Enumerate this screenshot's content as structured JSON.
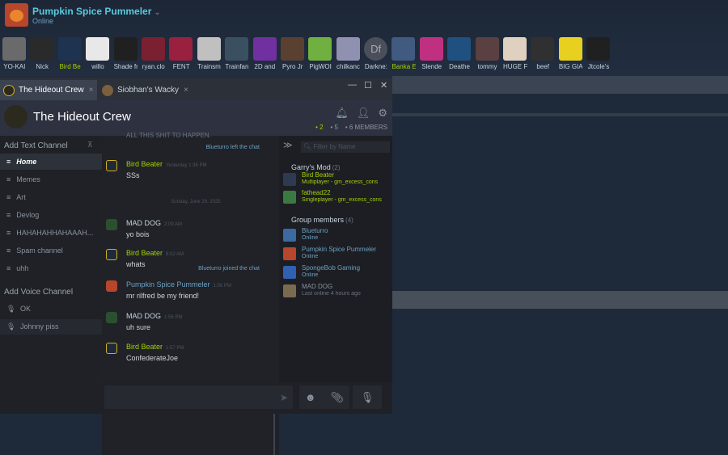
{
  "profile": {
    "name": "Pumpkin Spice Pummeler",
    "status": "Online"
  },
  "friends": [
    {
      "label": "YO-KAI",
      "color": "#6a6a6a",
      "ingame": false
    },
    {
      "label": "Nick",
      "color": "#2a2a2a",
      "ingame": false
    },
    {
      "label": "Bird Be",
      "color": "#1e3350",
      "ingame": true
    },
    {
      "label": "willo",
      "color": "#e8e8e8",
      "ingame": false
    },
    {
      "label": "Shade fr",
      "color": "#202020",
      "ingame": false
    },
    {
      "label": "ryan.clo",
      "color": "#7a2030",
      "ingame": false
    },
    {
      "label": "FENT",
      "color": "#9a2040",
      "ingame": false
    },
    {
      "label": "Trainsm",
      "color": "#c0c0c0",
      "ingame": false
    },
    {
      "label": "Trainfan",
      "color": "#3a5060",
      "ingame": false
    },
    {
      "label": "2D and",
      "color": "#7030a0",
      "ingame": false
    },
    {
      "label": "Pyro Jr",
      "color": "#5a4030",
      "ingame": false
    },
    {
      "label": "PigWOI",
      "color": "#70b040",
      "ingame": false
    },
    {
      "label": "chilkanc",
      "color": "#9090b0",
      "ingame": false
    },
    {
      "label": "Darkne:",
      "color": "#4a4f5a",
      "ingame": false,
      "initials": "Df"
    },
    {
      "label": "Banka E",
      "color": "#405a80",
      "ingame": true
    },
    {
      "label": "Slende",
      "color": "#c03080",
      "ingame": false
    },
    {
      "label": "Deathe",
      "color": "#205080",
      "ingame": false
    },
    {
      "label": "tommy",
      "color": "#5a4040",
      "ingame": false
    },
    {
      "label": "HUGE F",
      "color": "#e0d0c0",
      "ingame": false
    },
    {
      "label": "beef",
      "color": "#303030",
      "ingame": false
    },
    {
      "label": "BIG GIA",
      "color": "#e8d020",
      "ingame": false
    },
    {
      "label": "Jtcole's",
      "color": "#202020",
      "ingame": false
    }
  ],
  "tabs": [
    {
      "label": "The Hideout Crew",
      "close": "×"
    },
    {
      "label": "Siobhan's Wacky",
      "close": "×"
    }
  ],
  "window_controls": {
    "min": "—",
    "max": "☐",
    "close": "✕"
  },
  "group": {
    "name": "The Hideout Crew",
    "counts": {
      "ingame": "• 2",
      "online": "• 5",
      "members": "• 6 MEMBERS"
    }
  },
  "sidebar": {
    "text_header": "Add Text Channel",
    "channels": [
      "Home",
      "Memes",
      "Art",
      "Devlog",
      "HAHAHAHHAHAAAH...",
      "Spam channel",
      "uhh"
    ],
    "voice_header": "Add Voice Channel",
    "voice_channels": [
      "OK",
      "Johnny piss"
    ]
  },
  "chat": {
    "partial_line": "ALL THIS SHIT TO HAPPEN.",
    "system1": "Blueturro left the chat",
    "system2": "Blueturro joined the chat",
    "date_divider": "Sunday, June 29, 2025",
    "messages": [
      {
        "name": "Bird Beater",
        "time": "Yesterday 1:36 PM",
        "text": "SSs",
        "color": "g"
      },
      {
        "name": "MAD DOG",
        "time": "2:09 AM",
        "text": "yo bois",
        "color": "w"
      },
      {
        "name": "Bird Beater",
        "time": "8:02 AM",
        "text": "whats",
        "color": "g"
      },
      {
        "name": "Pumpkin Spice Pummeler",
        "time": "1:56 PM",
        "text": "mr rilfred be my friend!",
        "color": "b"
      },
      {
        "name": "MAD DOG",
        "time": "1:56 PM",
        "text": "uh sure",
        "color": "w"
      },
      {
        "name": "Bird Beater",
        "time": "1:57 PM",
        "text": "ConfederateJoe",
        "color": "g"
      }
    ]
  },
  "members": {
    "filter_placeholder": "Filter by Name",
    "groups": [
      {
        "title": "Garry's Mod",
        "count": "(2)"
      },
      {
        "title": "Group members",
        "count": "(4)"
      }
    ],
    "ingame": [
      {
        "name": "Bird Beater",
        "status": "Multiplayer - gm_excess_cons",
        "color": "#2e3a50"
      },
      {
        "name": "fathead22",
        "status": "Singleplayer - gm_excess_cons",
        "color": "#3a7a40"
      }
    ],
    "online": [
      {
        "name": "Blueturro",
        "status": "Online",
        "color": "#3a6aa0"
      },
      {
        "name": "Pumpkin Spice Pummeler",
        "status": "Online",
        "color": "#b6462c"
      },
      {
        "name": "SpongeBob Gaming",
        "status": "Online",
        "color": "#3060b0"
      }
    ],
    "offline": [
      {
        "name": "MAD DOG",
        "status": "Last online 4 hours ago",
        "color": "#7a6a50"
      }
    ]
  },
  "icons": {
    "bell": "bell-icon",
    "add_friend": "add-friend-icon",
    "settings": "gear-icon",
    "send": "send-icon",
    "emoji": "emoji-icon",
    "attach": "paperclip-icon",
    "voice": "voice-icon"
  }
}
